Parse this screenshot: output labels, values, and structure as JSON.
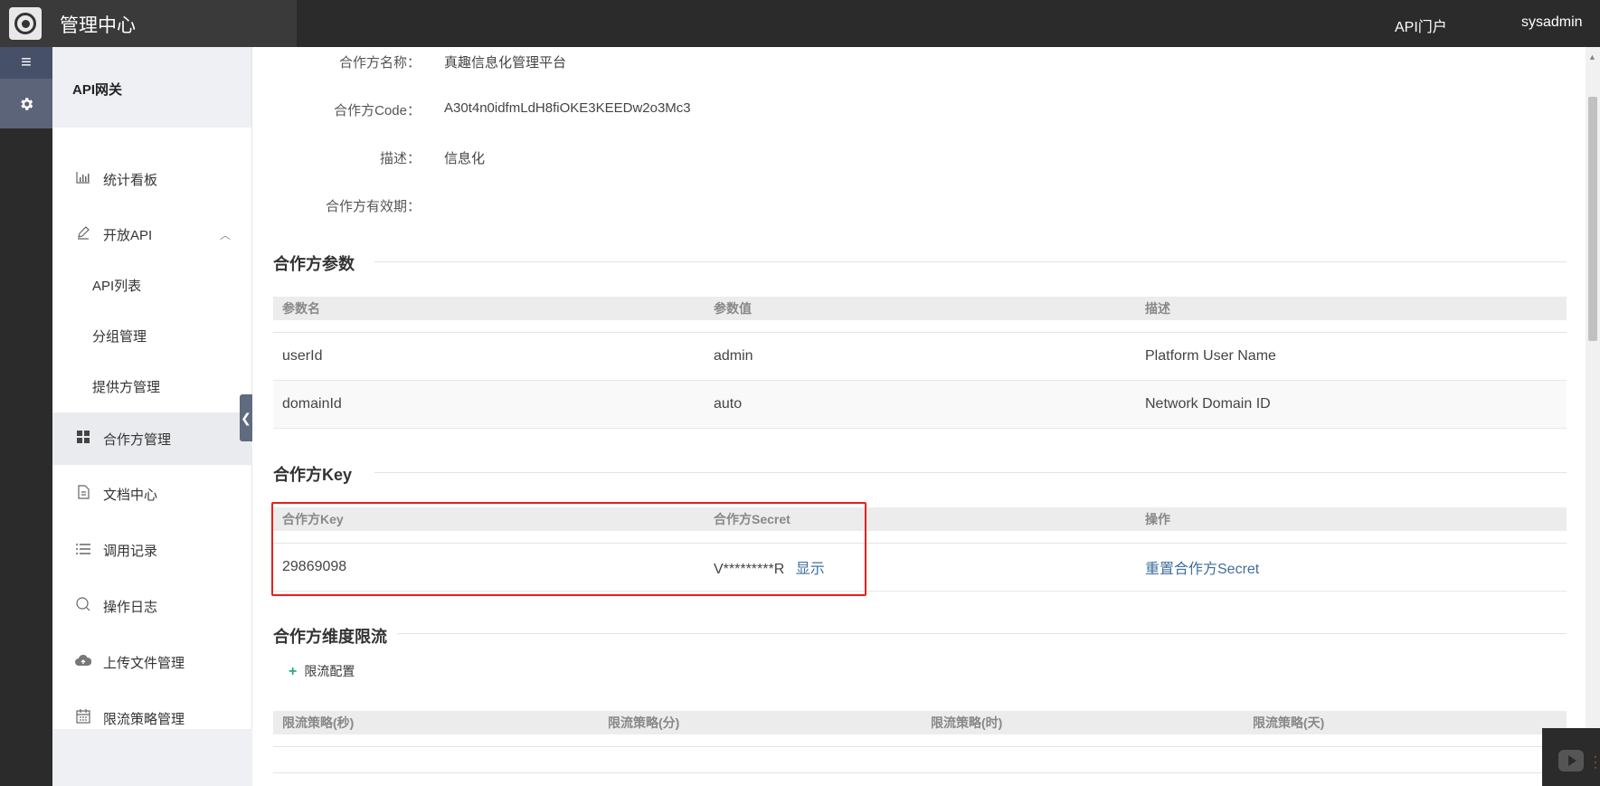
{
  "header": {
    "title": "管理中心",
    "portal_link": "API门户",
    "user": "sysadmin"
  },
  "sidebar": {
    "section_title": "API网关",
    "items": [
      {
        "label": "统计看板",
        "icon": "bar-chart-icon"
      },
      {
        "label": "开放API",
        "icon": "pencil-icon"
      },
      {
        "label": "API列表"
      },
      {
        "label": "分组管理"
      },
      {
        "label": "提供方管理"
      },
      {
        "label": "合作方管理",
        "icon": "grid-icon"
      },
      {
        "label": "文档中心",
        "icon": "document-icon"
      },
      {
        "label": "调用记录",
        "icon": "list-icon"
      },
      {
        "label": "操作日志",
        "icon": "search-icon"
      },
      {
        "label": "上传文件管理",
        "icon": "cloud-upload-icon"
      },
      {
        "label": "限流策略管理",
        "icon": "calendar-icon"
      }
    ]
  },
  "partner_info": {
    "name_label": "合作方名称：",
    "name_value": "真趣信息化管理平台",
    "code_label": "合作方Code：",
    "code_value": "A30t4n0idfmLdH8fiOKE3KEEDw2o3Mc3",
    "desc_label": "描述：",
    "desc_value": "信息化",
    "validity_label": "合作方有效期：",
    "validity_value": ""
  },
  "params_section": {
    "title": "合作方参数",
    "columns": [
      "参数名",
      "参数值",
      "描述"
    ],
    "rows": [
      [
        "userId",
        "admin",
        "Platform User Name"
      ],
      [
        "domainId",
        "auto",
        "Network Domain ID"
      ]
    ]
  },
  "key_section": {
    "title": "合作方Key",
    "columns": [
      "合作方Key",
      "合作方Secret",
      "操作"
    ],
    "row": {
      "key": "29869098",
      "secret": "V*********R",
      "show_link": "显示",
      "action": "重置合作方Secret"
    }
  },
  "limit_section": {
    "title": "合作方维度限流",
    "add_button": "限流配置",
    "columns": [
      "限流策略(秒)",
      "限流策略(分)",
      "限流策略(时)",
      "限流策略(天)"
    ]
  },
  "colors": {
    "topbar": "#2b2b2b",
    "link": "#3f6f9c",
    "highlight_border": "#e8201b",
    "add_icon": "#2aaa7a"
  }
}
